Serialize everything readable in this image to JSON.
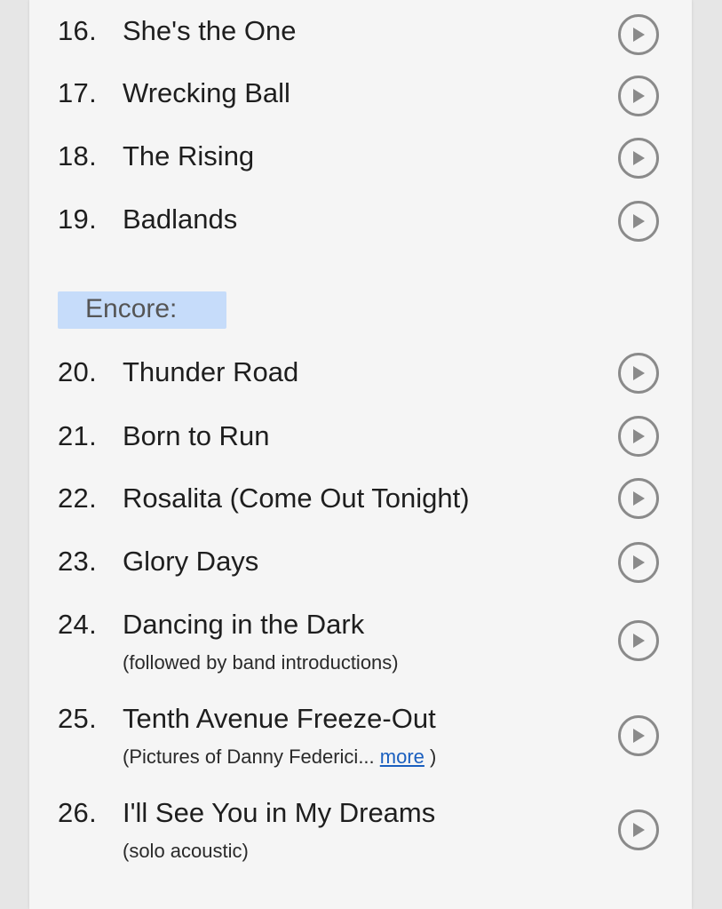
{
  "sections": {
    "encore_label": "Encore:"
  },
  "songs": [
    {
      "number": "16.",
      "title": "She's the One"
    },
    {
      "number": "17.",
      "title": "Wrecking Ball"
    },
    {
      "number": "18.",
      "title": "The Rising"
    },
    {
      "number": "19.",
      "title": "Badlands"
    },
    {
      "number": "20.",
      "title": "Thunder Road"
    },
    {
      "number": "21.",
      "title": "Born to Run"
    },
    {
      "number": "22.",
      "title": "Rosalita (Come Out Tonight)"
    },
    {
      "number": "23.",
      "title": "Glory Days"
    },
    {
      "number": "24.",
      "title": "Dancing in the Dark",
      "note": "(followed by band introductions)"
    },
    {
      "number": "25.",
      "title": "Tenth Avenue Freeze-Out",
      "note": "(Pictures of Danny Federici... ",
      "note_link": "more",
      "note_end": " )"
    },
    {
      "number": "26.",
      "title": "I'll See You in My Dreams",
      "note": "(solo acoustic)"
    }
  ],
  "icons": {
    "play": "play-circle-icon"
  },
  "colors": {
    "text": "#1e1e1e",
    "section_highlight": "#c6dcfa",
    "link": "#1a5fbf",
    "icon": "#8a8a8a"
  }
}
